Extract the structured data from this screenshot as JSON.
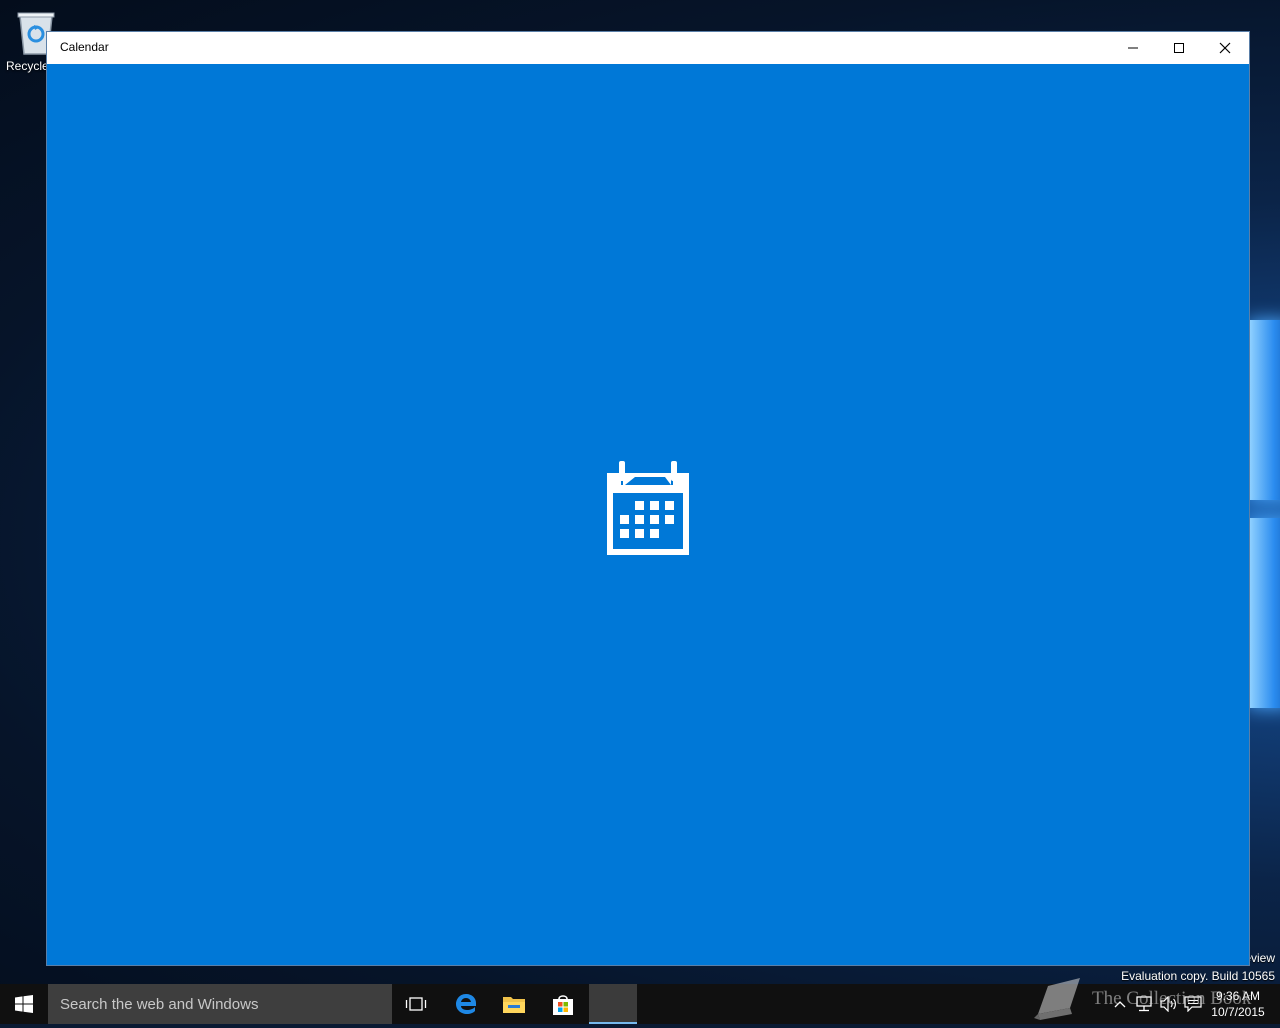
{
  "desktop": {
    "recycle_bin_label": "Recycle",
    "watermark_line1": "eview",
    "watermark_line2": "Evaluation copy. Build 10565"
  },
  "window": {
    "title": "Calendar",
    "splash_icon": "calendar-icon",
    "background_color": "#0078d7",
    "buttons": {
      "minimize": "minimize-icon",
      "maximize": "maximize-icon",
      "close": "close-icon"
    }
  },
  "taskbar": {
    "search_placeholder": "Search the web and Windows",
    "apps": [
      "task-view-icon",
      "edge-icon",
      "file-explorer-icon",
      "store-icon",
      "calendar-app"
    ],
    "clock": {
      "time": "9:36 AM",
      "date": "10/7/2015"
    }
  },
  "overlay": {
    "brand_text": "The Collection Book"
  }
}
